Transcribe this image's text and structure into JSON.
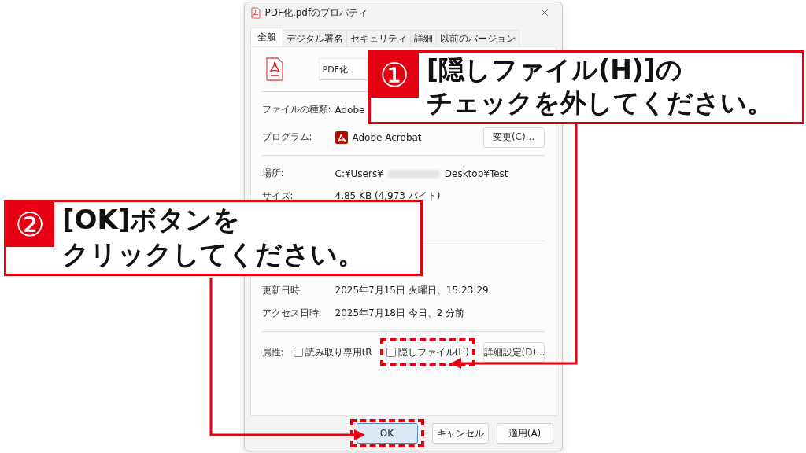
{
  "window": {
    "title": "PDF化.pdfのプロパティ"
  },
  "tabs": [
    {
      "label": "全般",
      "selected": true
    },
    {
      "label": "デジタル署名",
      "selected": false
    },
    {
      "label": "セキュリティ",
      "selected": false
    },
    {
      "label": "詳細",
      "selected": false
    },
    {
      "label": "以前のバージョン",
      "selected": false
    }
  ],
  "name_field": {
    "value": "PDF化."
  },
  "file_type": {
    "label": "ファイルの種類:",
    "value": "Adobe"
  },
  "program": {
    "label": "プログラム:",
    "value": "Adobe Acrobat",
    "button": "変更(C)..."
  },
  "location": {
    "label": "場所:",
    "value_start": "C:¥Users¥",
    "value_end": "Desktop¥Test"
  },
  "size": {
    "label": "サイズ:",
    "value": "4.85 KB (4,973 バイト)"
  },
  "modified": {
    "label": "更新日時:",
    "value": "2025年7月15日 火曜日、15:23:29"
  },
  "accessed": {
    "label": "アクセス日時:",
    "value": "2025年7月18日 今日、2 分前"
  },
  "attributes": {
    "label": "属性:",
    "checkboxes": [
      {
        "label": "読み取り専用(R",
        "checked": false,
        "highlighted": false
      },
      {
        "label": "隠しファイル(H)",
        "checked": false,
        "highlighted": true
      }
    ],
    "button": "詳細設定(D)..."
  },
  "buttons": [
    {
      "label": "OK",
      "default": true,
      "highlighted": true
    },
    {
      "label": "キャンセル",
      "default": false,
      "highlighted": false
    },
    {
      "label": "適用(A)",
      "default": false,
      "highlighted": false
    }
  ],
  "callouts": [
    {
      "number": "①",
      "lines": [
        "[隠しファイル(H)]の",
        "チェックを外してください。"
      ]
    },
    {
      "number": "②",
      "lines": [
        "[OK]ボタンを",
        "クリックしてください。"
      ]
    }
  ]
}
